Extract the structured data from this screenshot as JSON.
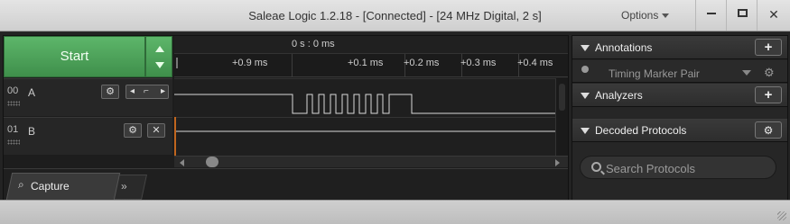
{
  "window": {
    "title": "Saleae Logic 1.2.18 - [Connected] - [24 MHz Digital, 2 s]",
    "options_label": "Options",
    "controls": [
      "minimize-icon",
      "maximize-icon",
      "close-icon"
    ]
  },
  "capture": {
    "start_label": "Start"
  },
  "ruler": {
    "center_label": "0 s : 0 ms",
    "ticks": [
      "+0.9 ms",
      "+0.1 ms",
      "+0.2 ms",
      "+0.3 ms",
      "+0.4 ms"
    ]
  },
  "channels": [
    {
      "number": "00",
      "name": "A",
      "trigger_icon": "rising-edge-icon"
    },
    {
      "number": "01",
      "name": "B"
    }
  ],
  "tabs": {
    "capture_label": "Capture",
    "more_glyph": "»"
  },
  "annotations": {
    "title": "Annotations",
    "marker_label": "Timing Marker Pair"
  },
  "analyzers": {
    "title": "Analyzers"
  },
  "decoded": {
    "title": "Decoded Protocols",
    "search_placeholder": "Search Protocols"
  },
  "colors": {
    "start_green": "#4aa559",
    "marker_orange": "#c0651e",
    "dark_bg": "#232323"
  }
}
